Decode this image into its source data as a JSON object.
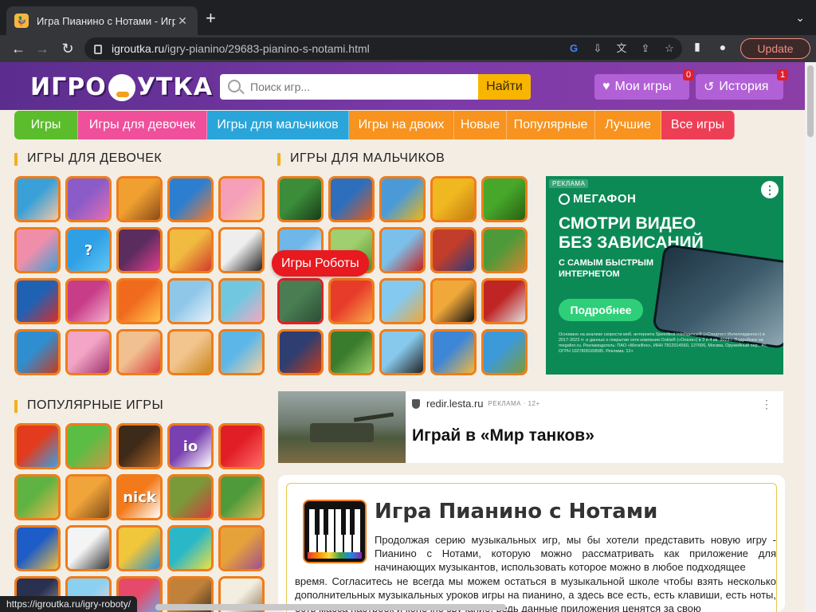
{
  "browser": {
    "tab_title": "Игра Пианино с Нотами - Игр",
    "tab_close": "✕",
    "new_tab": "+",
    "tab_menu": "⌄",
    "url_host": "igroutka.ru",
    "url_path": "/igry-pianino/29683-pianino-s-notami.html",
    "update_label": "Update",
    "status_url": "https://igroutka.ru/igry-roboty/"
  },
  "header": {
    "logo_left": "ИГРО",
    "logo_right": "УТКА",
    "search_placeholder": "Поиск игр...",
    "search_button": "Найти",
    "my_games_label": "Мои игры",
    "my_games_badge": "0",
    "history_label": "История",
    "history_badge": "1"
  },
  "nav": {
    "items": [
      {
        "label": "Игры",
        "color": "#5bbd2b"
      },
      {
        "label": "Игры для девочек",
        "color": "#ef4f9b"
      },
      {
        "label": "Игры для мальчиков",
        "color": "#2aa5d9"
      },
      {
        "label": "Игры на двоих",
        "color": "#f7931e"
      },
      {
        "label": "Новые",
        "color": "#f7931e"
      },
      {
        "label": "Популярные",
        "color": "#f7931e"
      },
      {
        "label": "Лучшие",
        "color": "#f7931e"
      },
      {
        "label": "Все игры",
        "color": "#ee3e56"
      }
    ]
  },
  "sections": {
    "girls_title": "ИГРЫ ДЛЯ ДЕВОЧЕК",
    "boys_title": "ИГРЫ ДЛЯ МАЛЬЧИКОВ",
    "popular_title": "ПОПУЛЯРНЫЕ ИГРЫ"
  },
  "tooltip": "Игры Роботы",
  "ads": {
    "megafon": {
      "tag": "РЕКЛАМА",
      "brand": "МЕГАФОН",
      "more": "⋮",
      "headline": "СМОТРИ ВИДЕО БЕЗ ЗАВИСАНИЙ",
      "sub": "С САМЫМ БЫСТРЫМ ИНТЕРНЕТОМ",
      "cta": "Подробнее",
      "legal": "Основано на анализе скорости моб. интернета Speedtest Intelligence® («Спидтест Интеллидженс») в 2017-2023 гг. и данных о покрытии сети компании Ookla® («Оокла») в 3 и 4 кв. 2023 г. Подробнее на megafon.ru. Рекламодатель: ПАО «МегаФон», ИНН 7812014560, 127006, Москва, Оружейный пер., 41, ОГРН 1027809169585. Реклама. 12+"
    },
    "tanks": {
      "source": "redir.lesta.ru",
      "label": "РЕКЛАМА · 12+",
      "kebab": "⋮",
      "title": "Играй в «Мир танков»"
    }
  },
  "article": {
    "title": "Игра Пианино с Нотами",
    "text_top": "Продолжая серию музыкальных игр, мы бы хотели представить новую игру - Пианино с Нотами, которую можно рассматривать как приложение для начинающих музыкантов, использовать которое можно в любое подходящее",
    "text_bottom": "время. Согласитесь не всегда мы можем остаться в музыкальной школе чтобы взять несколько дополнительных музыкальных уроков игры на пианино, а здесь все есть, есть клавиши, есть ноты, есть масса настроек и конечно звучание, ведь данные приложения ценятся за свою"
  },
  "tiles": {
    "girls": [
      [
        "#3aa0d8",
        "#f3c7a6"
      ],
      [
        "#8b5cc7",
        "#e56fb4"
      ],
      [
        "#f0a030",
        "#8a4a18"
      ],
      [
        "#2c7fd0",
        "#f27a2d"
      ],
      [
        "#f5a0b8",
        "#f6d0a0"
      ],
      [
        "#f08eaa",
        "#3aa0d8"
      ],
      [
        "#2fa0e6",
        "#60c6f4"
      ],
      [
        "#5b2c5e",
        "#e23f8e"
      ],
      [
        "#f0bb40",
        "#d03a2a"
      ],
      [
        "#eeeeee",
        "#222222"
      ],
      [
        "#1f62b4",
        "#d62c2c"
      ],
      [
        "#c83d88",
        "#f2b0d0"
      ],
      [
        "#f06a1e",
        "#ffc64a"
      ],
      [
        "#8fc7e8",
        "#e8f1fa"
      ],
      [
        "#70c8e0",
        "#f4a8c0"
      ],
      [
        "#2f8ed0",
        "#c53b22"
      ],
      [
        "#f3a5c5",
        "#a03070"
      ],
      [
        "#f0c090",
        "#d94040"
      ],
      [
        "#f2c48e",
        "#c9861c"
      ],
      [
        "#5cb7e8",
        "#f4d0a0"
      ]
    ],
    "boys": [
      [
        "#3c8d3a",
        "#173b17"
      ],
      [
        "#2d6fbd",
        "#e35a1b"
      ],
      [
        "#4b9ad8",
        "#f0b512"
      ],
      [
        "#f0b820",
        "#c27a10"
      ],
      [
        "#46a72a",
        "#2a5e12"
      ],
      [
        "#6fb7e9",
        "#ffffff"
      ],
      [
        "#9fcf6e",
        "#5c8f2a"
      ],
      [
        "#7bc0ea",
        "#c8201d"
      ],
      [
        "#c33d2b",
        "#2b3a7e"
      ],
      [
        "#4e9a3a",
        "#d2852e"
      ],
      [
        "#4a7d52",
        "#2a4e34"
      ],
      [
        "#e83c2a",
        "#f7a84a"
      ],
      [
        "#84c9f0",
        "#f0a83a"
      ],
      [
        "#f0a83a",
        "#111111"
      ],
      [
        "#c02525",
        "#e0e0e0"
      ],
      [
        "#2f3e70",
        "#c23a1e"
      ],
      [
        "#3a7c2e",
        "#9bd06a"
      ],
      [
        "#87c9ec",
        "#222222"
      ],
      [
        "#3d86d8",
        "#f0b840"
      ],
      [
        "#3d9ad8",
        "#7d9a3a"
      ]
    ],
    "popular": [
      [
        "#e33b1e",
        "#3aa0e6"
      ],
      [
        "#5bbd44",
        "#c89a44"
      ],
      [
        "#3e2a18",
        "#b56a2a"
      ],
      [
        "#7a3fb0",
        "#ffffff"
      ],
      [
        "#e11e26",
        "#ff6b6b"
      ],
      [
        "#5fb342",
        "#f0b84a"
      ],
      [
        "#f1a43a",
        "#7a4a1a"
      ],
      [
        "#f27a1a",
        "#ffffff"
      ],
      [
        "#7a9a3a",
        "#d23c3c"
      ],
      [
        "#4f9a3a",
        "#d8c05a"
      ],
      [
        "#1e5cc8",
        "#f0c040"
      ],
      [
        "#f4f4f4",
        "#333333"
      ],
      [
        "#f0c63a",
        "#2b8fd6"
      ],
      [
        "#2ab7c8",
        "#f0e040"
      ],
      [
        "#e6a23a",
        "#a04f8e"
      ],
      [
        "#2a3050",
        "#a0a0a0"
      ],
      [
        "#8bd0f0",
        "#ffd0d0"
      ],
      [
        "#e64a6a",
        "#64b5f6"
      ],
      [
        "#c0823a",
        "#3a2a18"
      ],
      [
        "#f2eee0",
        "#8a6a4a"
      ]
    ],
    "boys_highlight_index": 10,
    "glyphs": {
      "popular_io": "io",
      "popular_nick": "nick",
      "girls_help": "?"
    }
  }
}
